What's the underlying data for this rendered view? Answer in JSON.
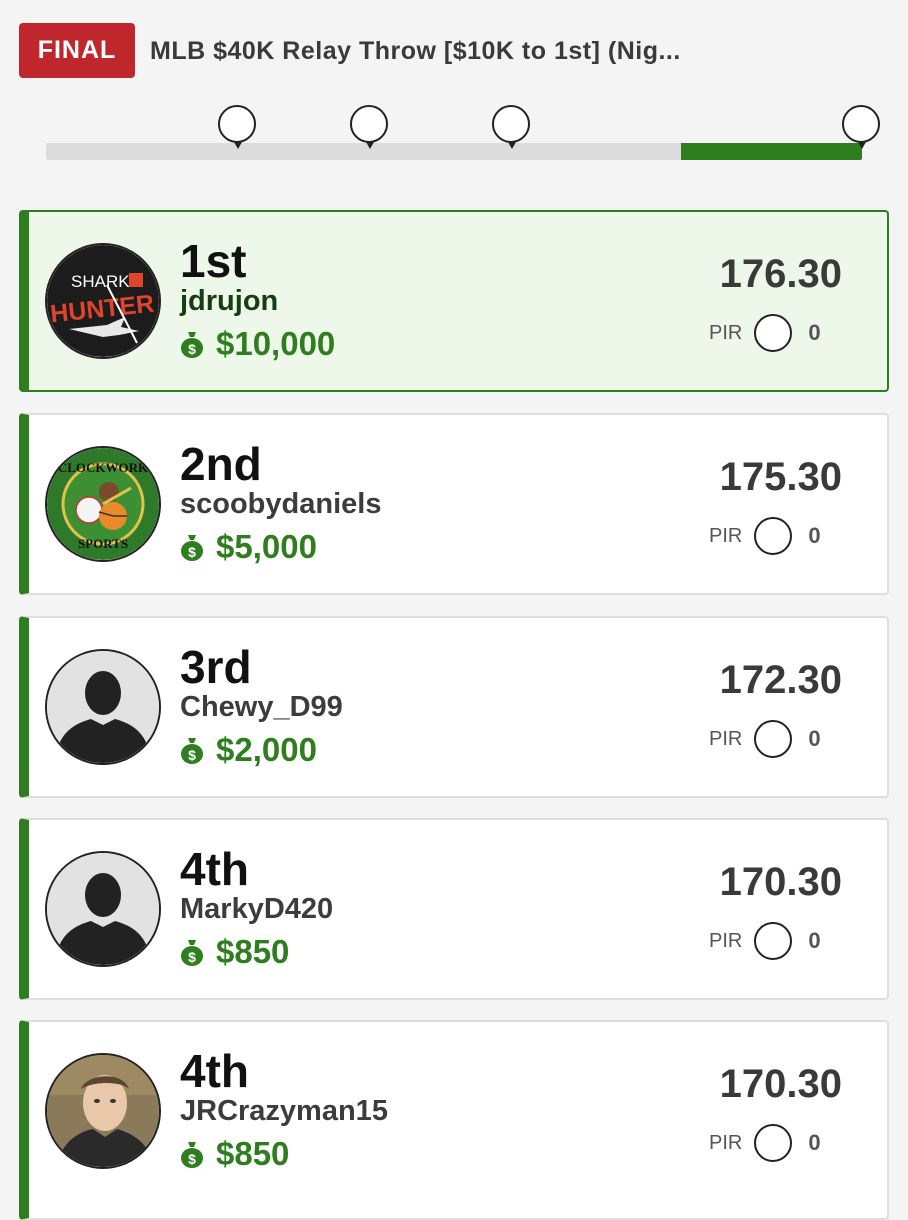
{
  "header": {
    "status_badge": "FINAL",
    "contest_title": "MLB $40K Relay Throw [$10K to 1st]  (Nig..."
  },
  "progress": {
    "complete_fraction": 0.78,
    "filled_from": 0.778,
    "markers": 4
  },
  "pir_label": "PIR",
  "colors": {
    "accent_green": "#2e7d1e",
    "final_red": "#c0272d",
    "winner_bg": "#eef8ea"
  },
  "entries": [
    {
      "rank": "1st",
      "username": "jdrujon",
      "prize": "$10,000",
      "score": "176.30",
      "pir": "0",
      "avatar": "shark-hunter-logo-icon"
    },
    {
      "rank": "2nd",
      "username": "scoobydaniels",
      "prize": "$5,000",
      "score": "175.30",
      "pir": "0",
      "avatar": "clockwork-sports-logo-icon"
    },
    {
      "rank": "3rd",
      "username": "Chewy_D99",
      "prize": "$2,000",
      "score": "172.30",
      "pir": "0",
      "avatar": "default-user-silhouette-icon"
    },
    {
      "rank": "4th",
      "username": "MarkyD420",
      "prize": "$850",
      "score": "170.30",
      "pir": "0",
      "avatar": "default-user-silhouette-icon"
    },
    {
      "rank": "4th",
      "username": "JRCrazyman15",
      "prize": "$850",
      "score": "170.30",
      "pir": "0",
      "avatar": "user-photo-icon"
    }
  ],
  "logos": {
    "shark_hunter": [
      "SHARK",
      "HUNTER"
    ],
    "clockwork": [
      "CLOCKWORK",
      "SPORTS"
    ]
  }
}
